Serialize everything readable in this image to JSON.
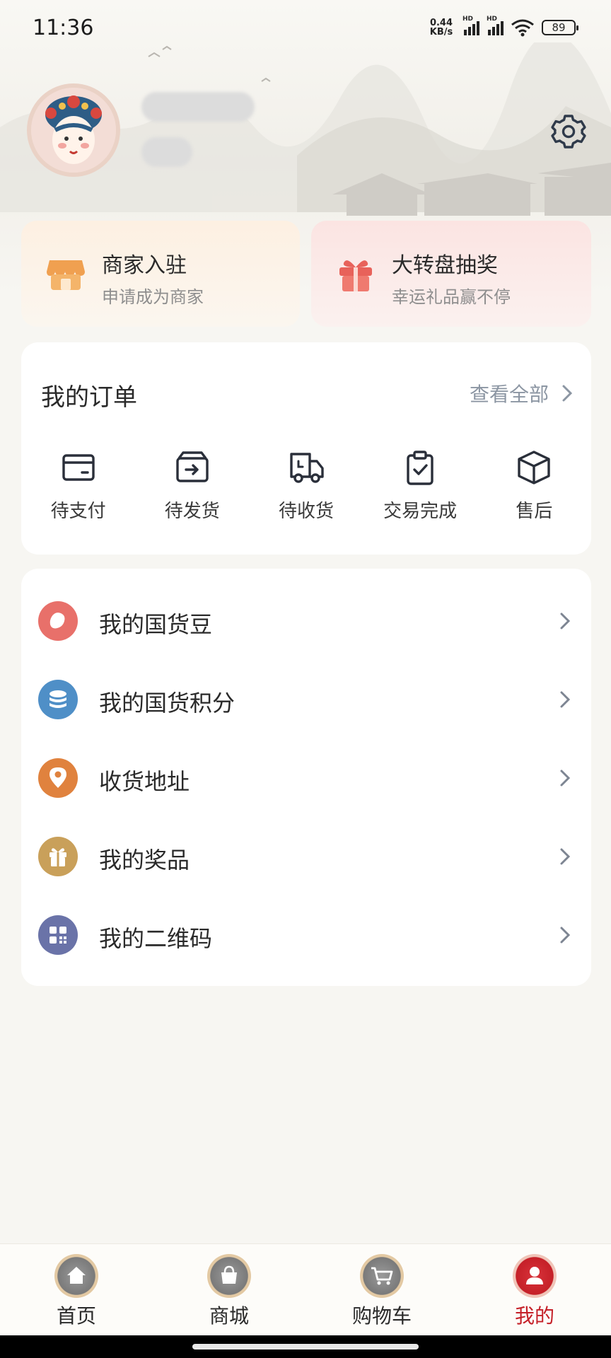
{
  "status_bar": {
    "time": "11:36",
    "net_speed_value": "0.44",
    "net_speed_unit": "KB/s",
    "signal1_label": "HD",
    "signal2_label": "HD",
    "battery": "89",
    "icons": [
      "signal-icon",
      "signal-icon",
      "wifi-icon",
      "battery-icon"
    ]
  },
  "profile": {
    "avatar": "opera-mask-avatar",
    "settings_icon": "gear-icon"
  },
  "promos": [
    {
      "title": "商家入驻",
      "subtitle": "申请成为商家",
      "icon": "store-icon"
    },
    {
      "title": "大转盘抽奖",
      "subtitle": "幸运礼品赢不停",
      "icon": "gift-icon"
    }
  ],
  "orders": {
    "title": "我的订单",
    "view_all": "查看全部",
    "items": [
      {
        "label": "待支付",
        "icon": "wallet-card-icon"
      },
      {
        "label": "待发货",
        "icon": "box-arrow-icon"
      },
      {
        "label": "待收货",
        "icon": "truck-icon"
      },
      {
        "label": "交易完成",
        "icon": "clipboard-check-icon"
      },
      {
        "label": "售后",
        "icon": "package-icon"
      }
    ]
  },
  "menu": [
    {
      "label": "我的国货豆",
      "icon": "bean-icon",
      "color": "#e8706a"
    },
    {
      "label": "我的国货积分",
      "icon": "coins-icon",
      "color": "#4f8fc7"
    },
    {
      "label": "收货地址",
      "icon": "location-pin-icon",
      "color": "#e0823e"
    },
    {
      "label": "我的奖品",
      "icon": "gift-icon",
      "color": "#c9a05a"
    },
    {
      "label": "我的二维码",
      "icon": "qr-code-icon",
      "color": "#6a73a8"
    }
  ],
  "bottom_nav": [
    {
      "label": "首页",
      "icon": "home-icon",
      "active": false
    },
    {
      "label": "商城",
      "icon": "shopping-bag-icon",
      "active": false
    },
    {
      "label": "购物车",
      "icon": "cart-icon",
      "active": false
    },
    {
      "label": "我的",
      "icon": "user-icon",
      "active": true
    }
  ],
  "colors": {
    "accent": "#c52028",
    "background": "#f7f6f2",
    "muted_text": "#8c96a3"
  }
}
